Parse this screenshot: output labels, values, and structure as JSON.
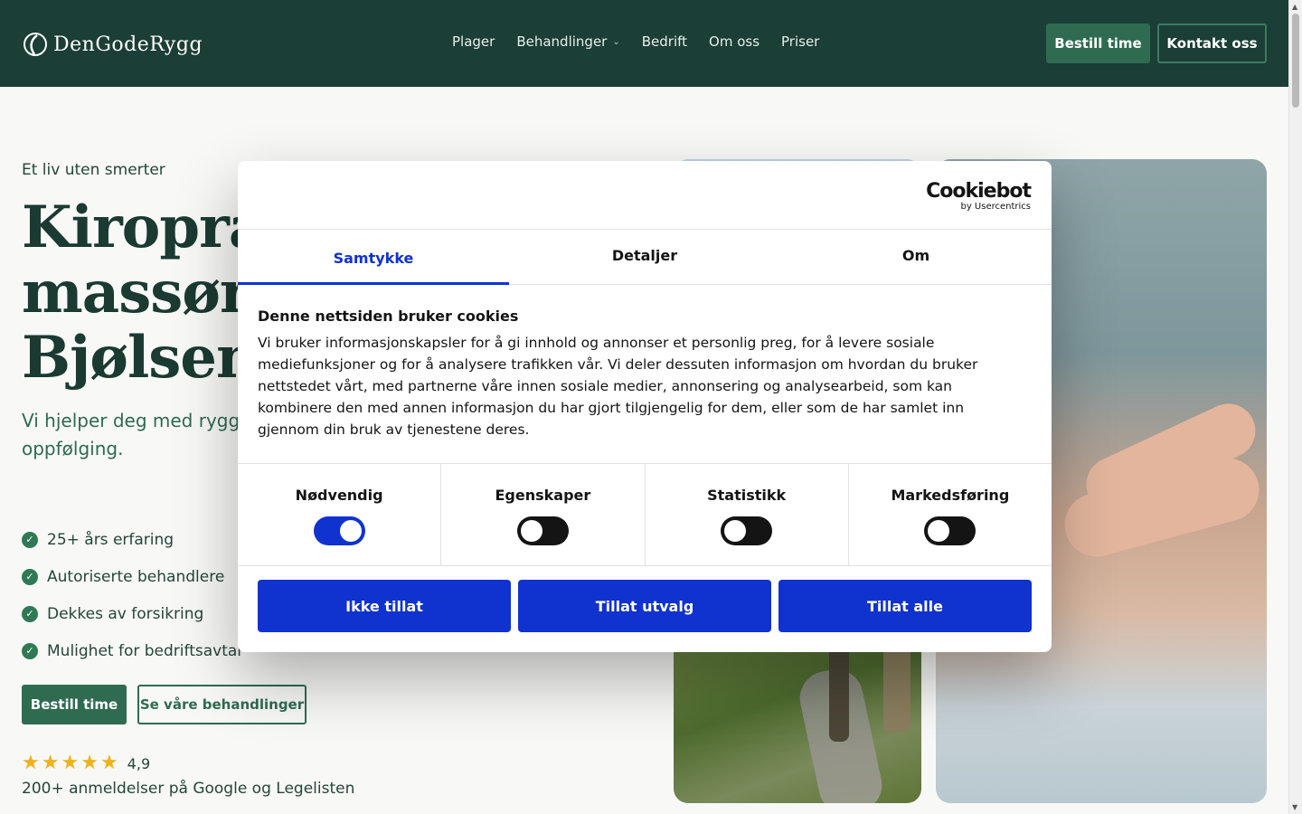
{
  "header": {
    "logo_text": "DenGodeRygg",
    "nav": [
      {
        "label": "Plager"
      },
      {
        "label": "Behandlinger",
        "has_dropdown": true
      },
      {
        "label": "Bedrift"
      },
      {
        "label": "Om oss"
      },
      {
        "label": "Priser"
      }
    ],
    "book_label": "Bestill time",
    "contact_label": "Kontakt oss"
  },
  "hero": {
    "eyebrow": "Et liv uten smerter",
    "title_lines": [
      "Kiropra",
      "massør",
      "Bjølsen"
    ],
    "subtitle": "Vi hjelper deg med rygg undersøkelse, individue oppfølging.",
    "features": [
      "25+ års erfaring",
      "Autoriserte behandlere",
      "Dekkes av forsikring",
      "Mulighet for bedriftsavtal"
    ],
    "book_label": "Bestill time",
    "treatments_label": "Se våre behandlinger",
    "rating_value": "4,9",
    "stars": 5,
    "reviews_text": "200+ anmeldelser på Google og Legelisten"
  },
  "cookie": {
    "brand_name": "Cookiebot",
    "brand_by": "by Usercentrics",
    "tabs": [
      {
        "label": "Samtykke",
        "active": true
      },
      {
        "label": "Detaljer",
        "active": false
      },
      {
        "label": "Om",
        "active": false
      }
    ],
    "heading": "Denne nettsiden bruker cookies",
    "body": "Vi bruker informasjonskapsler for å gi innhold og annonser et personlig preg, for å levere sosiale mediefunksjoner og for å analysere trafikken vår. Vi deler dessuten informasjon om hvordan du bruker nettstedet vårt, med partnerne våre innen sosiale medier, annonsering og analysearbeid, som kan kombinere den med annen informasjon du har gjort tilgjengelig for dem, eller som de har samlet inn gjennom din bruk av tjenestene deres.",
    "toggles": [
      {
        "label": "Nødvendig",
        "on": true
      },
      {
        "label": "Egenskaper",
        "on": false
      },
      {
        "label": "Statistikk",
        "on": false
      },
      {
        "label": "Markedsføring",
        "on": false
      }
    ],
    "buttons": [
      "Ikke tillat",
      "Tillat utvalg",
      "Tillat alle"
    ]
  },
  "colors": {
    "header_bg": "#1b3e36",
    "brand_green": "#2f6b51",
    "cookie_blue": "#1032cf",
    "star": "#f0b21a"
  }
}
